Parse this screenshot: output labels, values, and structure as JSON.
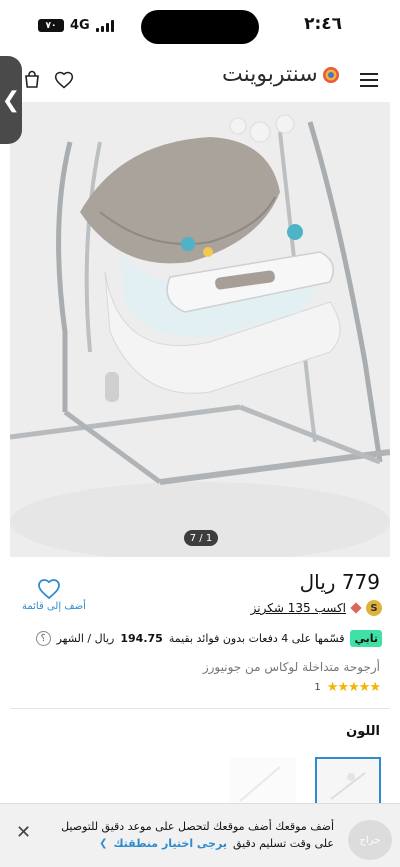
{
  "status_bar": {
    "time": "٢:٤٦",
    "network": "4G",
    "battery": "٧٠"
  },
  "header": {
    "logo_text": "سنتربوينت",
    "icons": [
      "menu-icon",
      "logo-mark-icon",
      "heart-icon",
      "cart-icon",
      "back-chevron-icon"
    ]
  },
  "gallery": {
    "pager": "7 / 1"
  },
  "product": {
    "price": "779 ريال",
    "wishlist_label": "أضف إلى قائمة",
    "points_badge": "S",
    "points_text": "اكسب 135 شكرنز",
    "tabby_logo": "تابي",
    "installment_text": "قسّمها على 4 دفعات بدون فوائد بقيمة",
    "installment_amount": "194.75",
    "installment_suffix": "ريال / الشهر",
    "info_symbol": "؟",
    "name": "أرجوحة متداخلة لوكاس من جونيورز",
    "rating": 5,
    "rating_stars": "★★★★★",
    "rating_count": "1",
    "color_label": "اللون"
  },
  "banner": {
    "line1": "أضف موقعك أضف موقعك لتحصل على موعد دقيق للتوصيل",
    "line2_prefix": "على وقت تسليم دقيق",
    "line2_link": "يرجى اختيار منطقتك",
    "chevron": "❯",
    "close": "✕",
    "watermark": "حراج"
  },
  "colors": {
    "accent": "#2f8bd0",
    "tabby": "#3fe1a7",
    "stars": "#f4b400",
    "back_tab": "#4a4a4a"
  }
}
